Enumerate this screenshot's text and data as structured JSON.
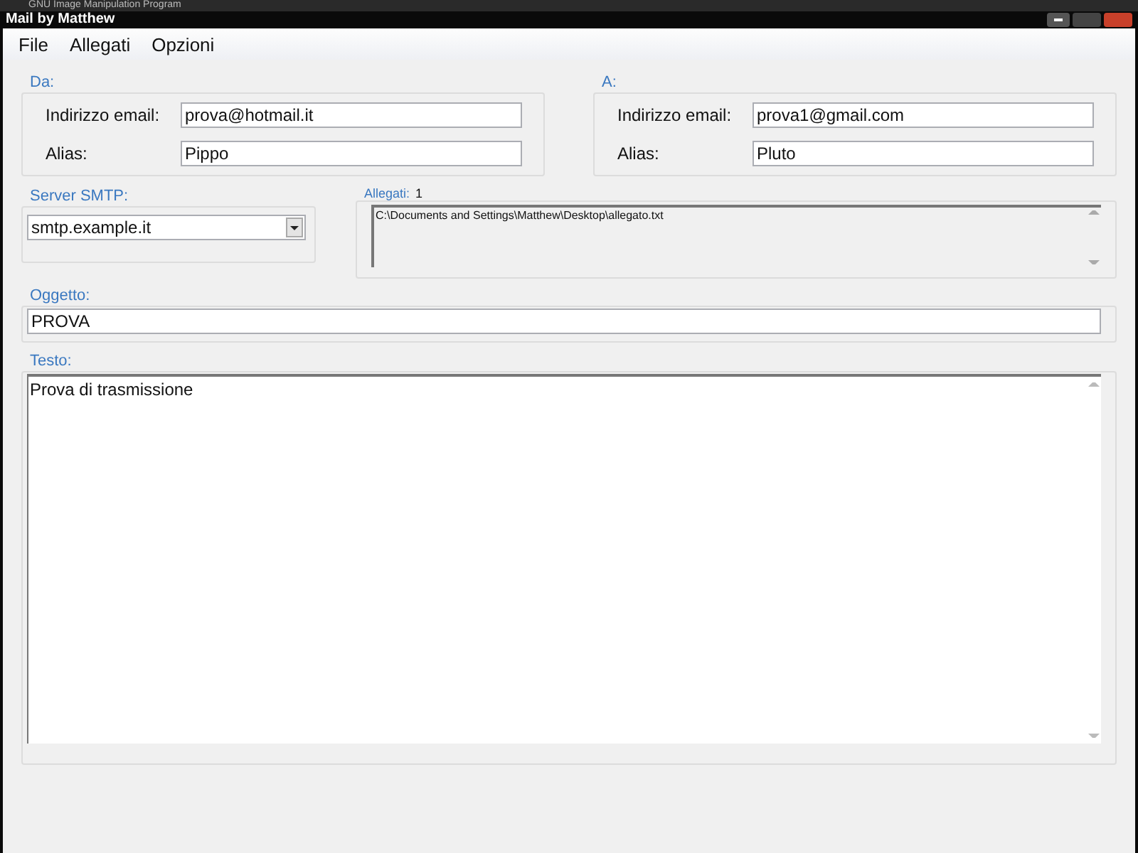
{
  "background_window": {
    "title": "GNU Image Manipulation Program"
  },
  "window": {
    "title": "Mail by Matthew"
  },
  "menu": [
    "File",
    "Allegati",
    "Opzioni"
  ],
  "sender": {
    "legend": "Da:",
    "email_label": "Indirizzo email:",
    "email": "prova@hotmail.it",
    "alias_label": "Alias:",
    "alias": "Pippo"
  },
  "recipient": {
    "legend": "A:",
    "email_label": "Indirizzo email:",
    "email": "prova1@gmail.com",
    "alias_label": "Alias:",
    "alias": "Pluto"
  },
  "smtp": {
    "legend": "Server SMTP:",
    "value": "smtp.example.it"
  },
  "attachments": {
    "legend": "Allegati:",
    "count": "1",
    "files": [
      "C:\\Documents and Settings\\Matthew\\Desktop\\allegato.txt"
    ]
  },
  "subject": {
    "legend": "Oggetto:",
    "value": "PROVA"
  },
  "body": {
    "legend": "Testo:",
    "value": "Prova di trasmissione"
  }
}
